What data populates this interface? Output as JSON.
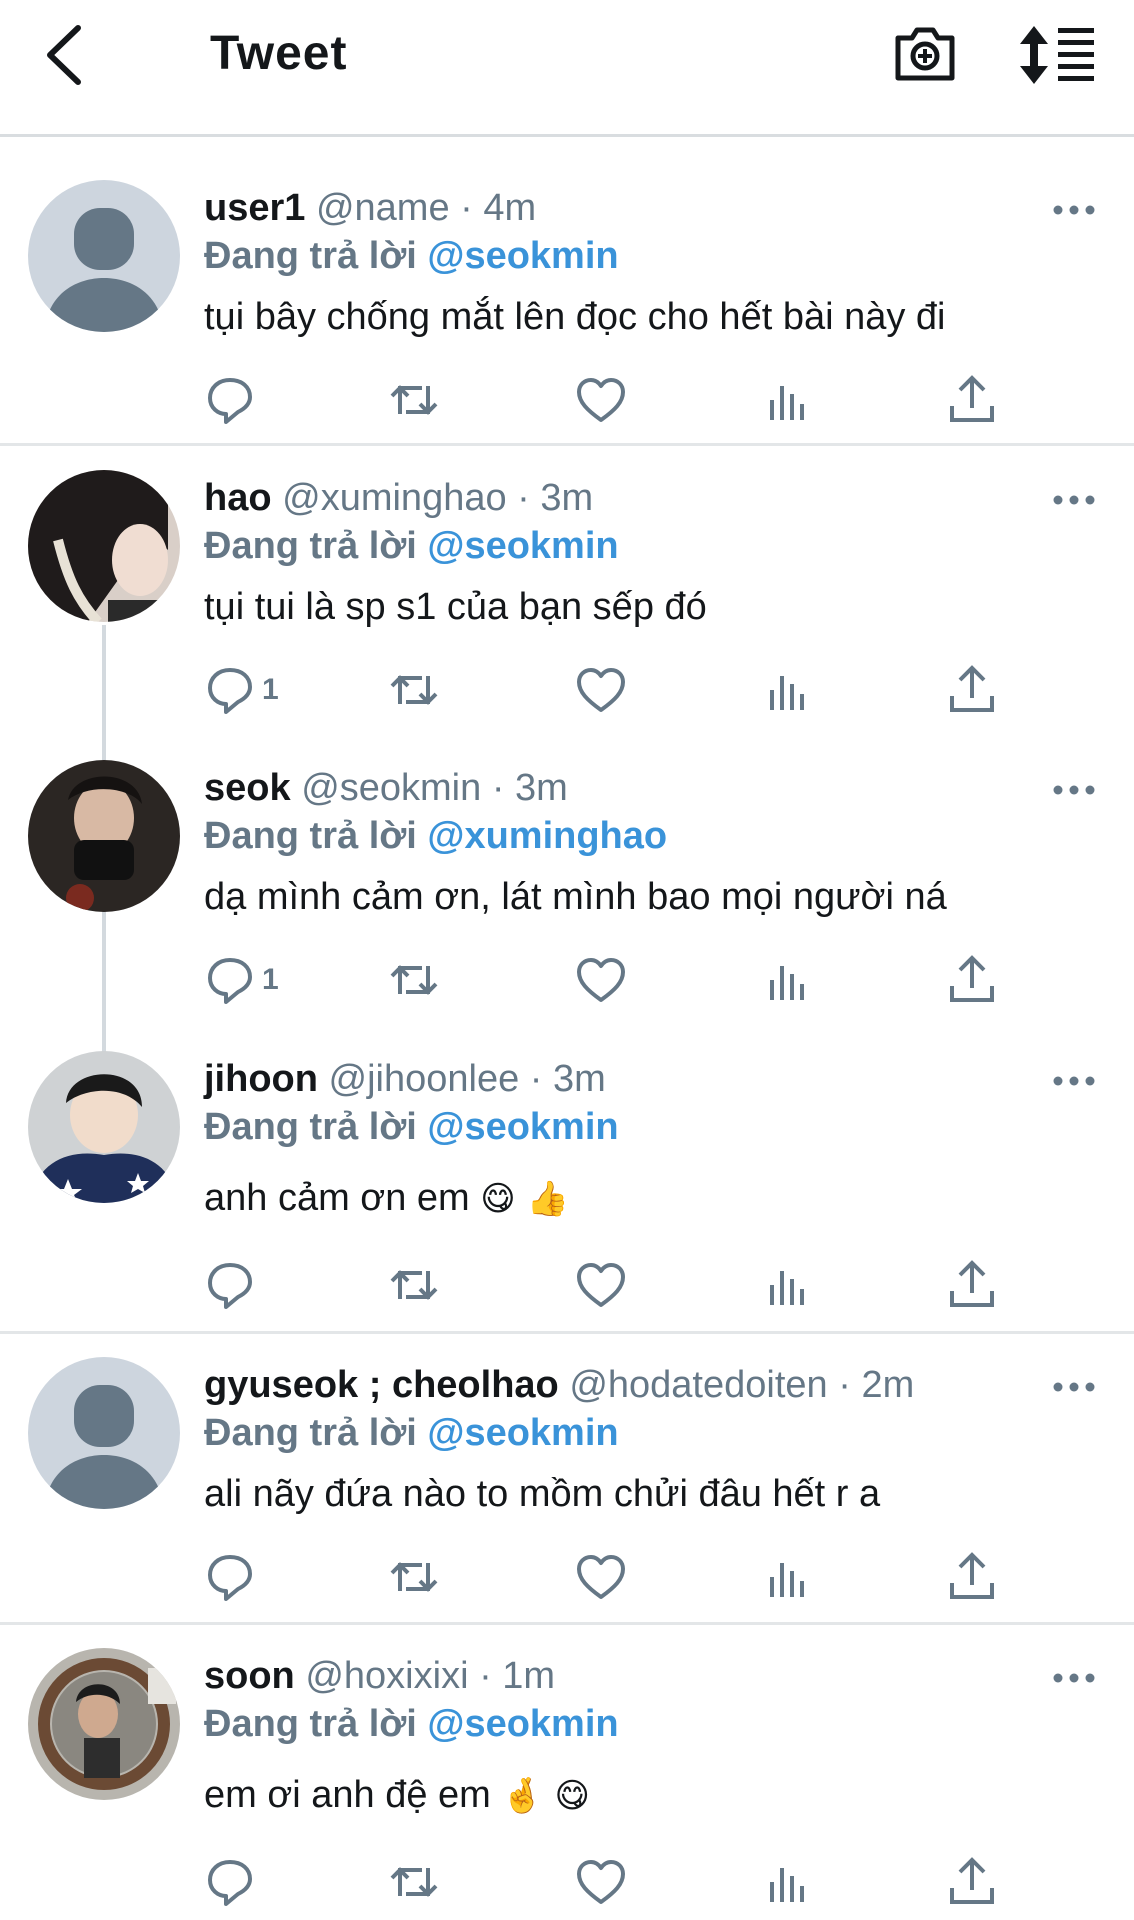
{
  "header": {
    "title": "Tweet",
    "back_icon": "chevron-left-icon",
    "camera_icon": "camera-plus-icon",
    "sort_icon": "sort-list-icon"
  },
  "reply_prefix": "Đang trả lời",
  "colors": {
    "accent": "#3a93d9",
    "muted": "#657786",
    "avatar_default": "#cdd5de"
  },
  "tweets": [
    {
      "name": "user1",
      "handle": "@name",
      "time": "4m",
      "reply_to": "@seokmin",
      "text": "tụi bây chống mắt lên đọc cho hết bài này đi",
      "reply_count": ""
    },
    {
      "name": "hao",
      "handle": "@xuminghao",
      "time": "3m",
      "reply_to": "@seokmin",
      "text": "tụi tui là sp s1 của bạn sếp đó",
      "reply_count": "1"
    },
    {
      "name": "seok",
      "handle": "@seokmin",
      "time": "3m",
      "reply_to": "@xuminghao",
      "text": "dạ mình cảm ơn, lát mình bao mọi người ná",
      "reply_count": "1"
    },
    {
      "name": "jihoon",
      "handle": "@jihoonlee",
      "time": "3m",
      "reply_to": "@seokmin",
      "text": "anh cảm ơn em",
      "emoji": "😋 👍",
      "reply_count": ""
    },
    {
      "name": "gyuseok ; cheolhao",
      "handle": "@hodatedoiten",
      "time": "2m",
      "reply_to": "@seokmin",
      "text": "ali nãy đứa nào to mồm chửi đâu hết r a",
      "reply_count": ""
    },
    {
      "name": "soon",
      "handle": "@hoxixixi",
      "time": "1m",
      "reply_to": "@seokmin",
      "text": "em ơi anh đệ em",
      "emoji": "🤞 😋",
      "reply_count": ""
    }
  ]
}
